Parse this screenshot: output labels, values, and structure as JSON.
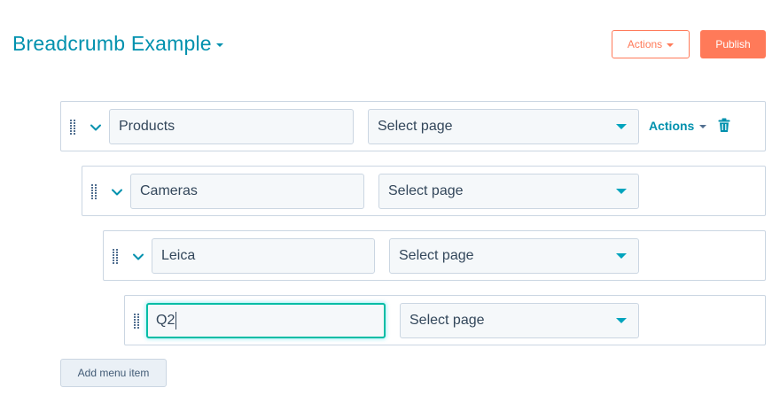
{
  "header": {
    "title": "Breadcrumb Example",
    "actions_label": "Actions",
    "publish_label": "Publish"
  },
  "colors": {
    "accent": "#0091ae",
    "brand": "#ff7a59",
    "focus": "#00bda5"
  },
  "menu_items": [
    {
      "name": "Products",
      "page": "Select page",
      "level": 1,
      "expanded": true,
      "actions_label": "Actions"
    },
    {
      "name": "Cameras",
      "page": "Select page",
      "level": 2,
      "expanded": true
    },
    {
      "name": "Leica",
      "page": "Select page",
      "level": 3,
      "expanded": true
    },
    {
      "name": "Q2",
      "page": "Select page",
      "level": 4,
      "focused": true
    }
  ],
  "footer": {
    "add_label": "Add menu item"
  },
  "icons": [
    "drag-handle-icon",
    "chevron-down-icon",
    "caret-down-icon",
    "trash-icon"
  ]
}
